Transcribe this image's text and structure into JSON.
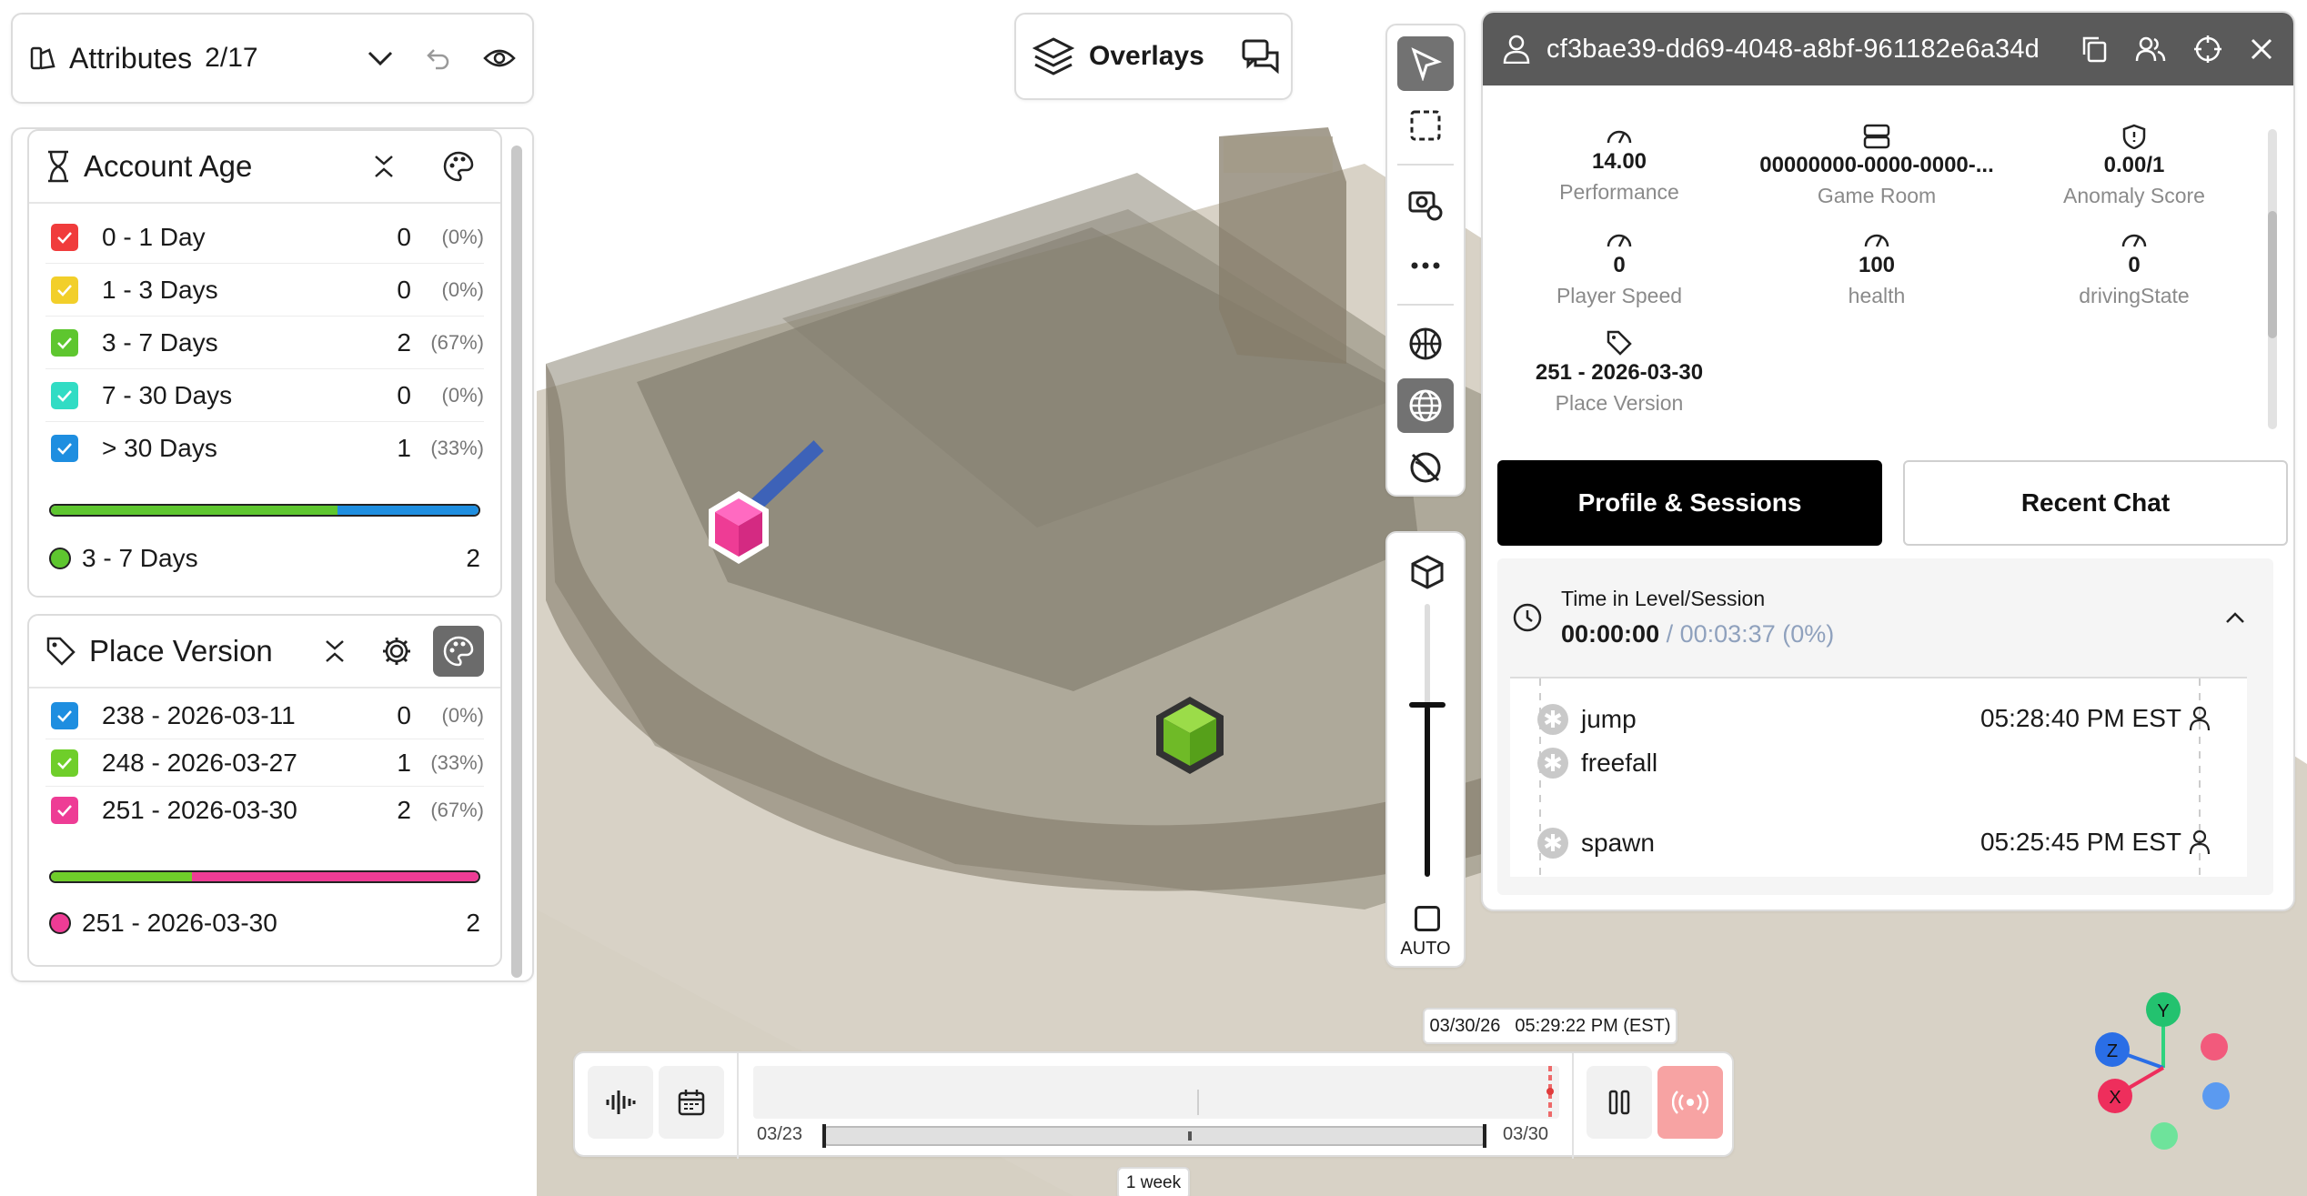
{
  "attributes": {
    "title": "Attributes",
    "count": "2/17"
  },
  "account_age": {
    "title": "Account Age",
    "rows": [
      {
        "label": "0 - 1 Day",
        "count": "0",
        "pct": "(0%)",
        "color": "#f03c3c"
      },
      {
        "label": "1 - 3 Days",
        "count": "0",
        "pct": "(0%)",
        "color": "#f2cf2a"
      },
      {
        "label": "3 - 7 Days",
        "count": "2",
        "pct": "(67%)",
        "color": "#5ec62f"
      },
      {
        "label": "7 - 30 Days",
        "count": "0",
        "pct": "(0%)",
        "color": "#31dcc4"
      },
      {
        "label": "> 30 Days",
        "count": "1",
        "pct": "(33%)",
        "color": "#1e8ee0"
      }
    ],
    "bar": [
      {
        "color": "#5ec62f",
        "fraction": 0.67
      },
      {
        "color": "#1e8ee0",
        "fraction": 0.33
      }
    ],
    "selected": {
      "label": "3 - 7 Days",
      "count": "2",
      "color": "#5ec62f"
    }
  },
  "place_version": {
    "title": "Place Version",
    "rows": [
      {
        "label": "238 - 2026-03-11",
        "count": "0",
        "pct": "(0%)",
        "color": "#1e8ee0"
      },
      {
        "label": "248 - 2026-03-27",
        "count": "1",
        "pct": "(33%)",
        "color": "#6fce2a"
      },
      {
        "label": "251 - 2026-03-30",
        "count": "2",
        "pct": "(67%)",
        "color": "#ee3c95"
      }
    ],
    "bar": [
      {
        "color": "#6fce2a",
        "fraction": 0.33
      },
      {
        "color": "#ee3c95",
        "fraction": 0.67
      }
    ],
    "selected": {
      "label": "251 - 2026-03-30",
      "count": "2",
      "color": "#ee3c95"
    }
  },
  "overlays": {
    "label": "Overlays"
  },
  "slider": {
    "auto_label": "AUTO"
  },
  "player": {
    "id": "cf3bae39-dd69-4048-a8bf-961182e6a34d",
    "stats": [
      {
        "value": "14.00",
        "name": "Performance",
        "icon": "gauge-icon"
      },
      {
        "value": "00000000-0000-0000-...",
        "name": "Game Room",
        "icon": "server-icon"
      },
      {
        "value": "0.00/1",
        "name": "Anomaly Score",
        "icon": "shield-icon"
      },
      {
        "value": "0",
        "name": "Player Speed",
        "icon": "gauge-icon"
      },
      {
        "value": "100",
        "name": "health",
        "icon": "gauge-icon"
      },
      {
        "value": "0",
        "name": "drivingState",
        "icon": "gauge-icon"
      },
      {
        "value": "251 - 2026-03-30",
        "name": "Place Version",
        "icon": "tag-icon"
      }
    ],
    "tabs": {
      "profile": "Profile & Sessions",
      "chat": "Recent Chat"
    },
    "timeline": {
      "title": "Time in Level/Session",
      "current": "00:00:00",
      "total": "/ 00:03:37 (0%)",
      "events": [
        {
          "label": "jump",
          "time": "05:28:40 PM EST"
        },
        {
          "label": "freefall",
          "time": ""
        },
        {
          "label": "spawn",
          "time": "05:25:45 PM EST"
        }
      ]
    }
  },
  "bottom": {
    "start_date": "03/23",
    "end_date": "03/30",
    "tooltip_date": "03/30/26",
    "tooltip_time": "05:29:22 PM (EST)",
    "range_label": "1 week"
  },
  "axes": {
    "y": "Y",
    "z": "Z",
    "x": "X"
  }
}
